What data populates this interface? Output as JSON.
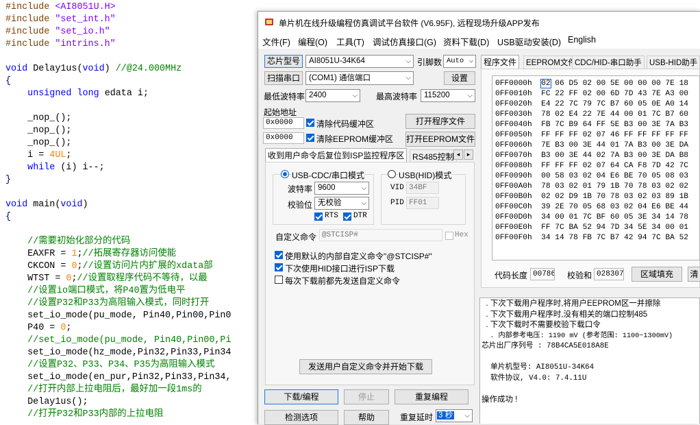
{
  "editor": {
    "lines": [
      {
        "parts": [
          [
            "pp",
            "#include "
          ],
          [
            "str",
            "<AI8051U.H>"
          ]
        ]
      },
      {
        "parts": [
          [
            "pp",
            "#include "
          ],
          [
            "str",
            "\"set_int.h\""
          ]
        ]
      },
      {
        "parts": [
          [
            "pp",
            "#include "
          ],
          [
            "str",
            "\"set_io.h\""
          ]
        ]
      },
      {
        "parts": [
          [
            "pp",
            "#include "
          ],
          [
            "str",
            "\"intrins.h\""
          ]
        ]
      },
      {
        "parts": []
      },
      {
        "parts": [
          [
            "kw",
            "void"
          ],
          [
            "tx",
            " Delay1us("
          ],
          [
            "kw",
            "void"
          ],
          [
            "tx",
            ") "
          ],
          [
            "cm",
            "//@24.000MHz"
          ]
        ]
      },
      {
        "parts": [
          [
            "op",
            "{"
          ]
        ]
      },
      {
        "parts": [
          [
            "tx",
            "    "
          ],
          [
            "kw",
            "unsigned"
          ],
          [
            "tx",
            " "
          ],
          [
            "kw",
            "long"
          ],
          [
            "tx",
            " edata i;"
          ]
        ]
      },
      {
        "parts": []
      },
      {
        "parts": [
          [
            "tx",
            "    _nop_();"
          ]
        ]
      },
      {
        "parts": [
          [
            "tx",
            "    _nop_();"
          ]
        ]
      },
      {
        "parts": [
          [
            "tx",
            "    _nop_();"
          ]
        ]
      },
      {
        "parts": [
          [
            "tx",
            "    i = "
          ],
          [
            "num",
            "4UL"
          ],
          [
            "tx",
            ";"
          ]
        ]
      },
      {
        "parts": [
          [
            "tx",
            "    "
          ],
          [
            "kw",
            "while"
          ],
          [
            "tx",
            " (i) i--;"
          ]
        ]
      },
      {
        "parts": [
          [
            "op",
            "}"
          ]
        ]
      },
      {
        "parts": []
      },
      {
        "parts": [
          [
            "kw",
            "void"
          ],
          [
            "tx",
            " main("
          ],
          [
            "kw",
            "void"
          ],
          [
            "tx",
            ")"
          ]
        ]
      },
      {
        "parts": [
          [
            "op",
            "{"
          ]
        ]
      },
      {
        "parts": []
      },
      {
        "parts": [
          [
            "tx",
            "    "
          ],
          [
            "cm",
            "//需要初始化部分的代码"
          ]
        ]
      },
      {
        "parts": [
          [
            "tx",
            "    EAXFR = "
          ],
          [
            "num",
            "1"
          ],
          [
            "tx",
            ";"
          ],
          [
            "cm",
            "//拓展寄存器访问使能"
          ]
        ]
      },
      {
        "parts": [
          [
            "tx",
            "    CKCON = "
          ],
          [
            "num",
            "0"
          ],
          [
            "tx",
            ";"
          ],
          [
            "cm",
            "//设置访问片内扩展的xdata部"
          ]
        ]
      },
      {
        "parts": [
          [
            "tx",
            "    WTST = "
          ],
          [
            "num",
            "0"
          ],
          [
            "tx",
            ";"
          ],
          [
            "cm",
            "//设置取程序代码不等待，以最"
          ]
        ]
      },
      {
        "parts": [
          [
            "tx",
            "    "
          ],
          [
            "cm",
            "//设置io端口模式，将P40置为低电平"
          ]
        ]
      },
      {
        "parts": [
          [
            "tx",
            "    "
          ],
          [
            "cm",
            "//设置P32和P33为高阻输入模式，同时打开"
          ]
        ]
      },
      {
        "parts": [
          [
            "tx",
            "    set_io_mode(pu_mode, Pin40,Pin00,Pin0"
          ]
        ]
      },
      {
        "parts": [
          [
            "tx",
            "    P40 = "
          ],
          [
            "num",
            "0"
          ],
          [
            "tx",
            ";"
          ]
        ]
      },
      {
        "parts": [
          [
            "tx",
            "    "
          ],
          [
            "cm",
            "//set_io_mode(pu_mode, Pin40,Pin00,Pi"
          ]
        ]
      },
      {
        "parts": [
          [
            "tx",
            "    set_io_mode(hz_mode,Pin32,Pin33,Pin34"
          ]
        ]
      },
      {
        "parts": [
          [
            "tx",
            "    "
          ],
          [
            "cm",
            "//设置P32、P33、P34、P35为高阻输入模式"
          ]
        ]
      },
      {
        "parts": [
          [
            "tx",
            "    set_io_mode(en_pur,Pin32,Pin33,Pin34,"
          ]
        ]
      },
      {
        "parts": [
          [
            "tx",
            "    "
          ],
          [
            "cm",
            "//打开内部上拉电阻后，最好加一段1ms的"
          ]
        ]
      },
      {
        "parts": [
          [
            "tx",
            "    Delay1us();"
          ]
        ]
      },
      {
        "parts": [
          [
            "tx",
            "    "
          ],
          [
            "cm",
            "//打开P32和P33内部的上拉电阻"
          ]
        ]
      }
    ]
  },
  "window": {
    "title": "单片机在线升级编程仿真调试平台软件 (V6.95F), 远程现场升级APP发布",
    "menu": [
      "文件(F)",
      "编程(O)",
      "工具(T)",
      "调试仿真接口(G)",
      "资料下载(D)",
      "USB驱动安装(D)",
      "English"
    ]
  },
  "left": {
    "chip_type_btn": "芯片型号",
    "chip_type_value": "AI8051U-34K64",
    "pins_label": "引脚数",
    "pins_value": "Auto",
    "scan_btn": "扫描串口",
    "port_value": "(COM1) 通信端口",
    "settings_btn": "设置",
    "min_baud_label": "最低波特率",
    "min_baud_value": "2400",
    "max_baud_label": "最高波特率",
    "max_baud_value": "115200",
    "start_addr_label": "起始地址",
    "addr1": "0x0000",
    "clear_code_label": "清除代码缓冲区",
    "open_prog_btn": "打开程序文件",
    "addr2": "0x0000",
    "clear_eeprom_label": "清除EEPROM缓冲区",
    "open_eeprom_btn": "打开EEPROM文件",
    "tab_isp": "收到用户命令后复位到ISP监控程序区",
    "tab_rs485": "RS485控制",
    "usb_cdc_label": "USB-CDC/串口模式",
    "usb_hid_label": "USB(HID)模式",
    "baud_label": "波特率",
    "baud_value": "9600",
    "parity_label": "校验位",
    "parity_value": "无校验",
    "rts_label": "RTS",
    "dtr_label": "DTR",
    "vid_label": "VID",
    "vid_value": "34BF",
    "pid_label": "PID",
    "pid_value": "FF01",
    "custom_cmd_label": "自定义命令",
    "custom_cmd_value": "@STCISP#",
    "hex_label": "Hex",
    "use_default_label": "使用默认的内部自定义命令\"@STCISP#\"",
    "hid_isp_label": "下次使用HID接口进行ISP下载",
    "send_each_label": "每次下载前都先发送自定义命令",
    "send_custom_btn": "发送用户自定义命令并开始下载",
    "download_btn": "下载/编程",
    "stop_btn": "停止",
    "reprogram_btn": "重复编程",
    "check_btn": "检测选项",
    "help_btn": "帮助",
    "repeat_delay_label": "重复延时",
    "repeat_delay_value": "3 秒"
  },
  "right": {
    "tabs": [
      "程序文件",
      "EEPROM文件",
      "CDC/HID-串口助手",
      "USB-HID助手"
    ],
    "hex_rows": [
      {
        "addr": "0FF0000h",
        "bytes": "02 06 D5 02 00 5E 00 00 00 7E 18"
      },
      {
        "addr": "0FF0010h",
        "bytes": "FC 22 FF 02 00 6D 7D 43 7E A3 00"
      },
      {
        "addr": "0FF0020h",
        "bytes": "E4 22 7C 79 7C B7 60 05 0E A0 14"
      },
      {
        "addr": "0FF0030h",
        "bytes": "78 02 E4 22 7E 44 00 01 7C B7 60"
      },
      {
        "addr": "0FF0040h",
        "bytes": "FB 7C B9 64 FF 5E B3 00 3E 7A B3"
      },
      {
        "addr": "0FF0050h",
        "bytes": "FF FF FF 02 07 46 FF FF FF FF FF"
      },
      {
        "addr": "0FF0060h",
        "bytes": "7E B3 00 3E 44 01 7A B3 00 3E DA"
      },
      {
        "addr": "0FF0070h",
        "bytes": "B3 00 3E 44 02 7A B3 00 3E DA B8"
      },
      {
        "addr": "0FF0080h",
        "bytes": "FF FF FF 02 07 64 CA F8 7D 42 7C"
      },
      {
        "addr": "0FF0090h",
        "bytes": "00 58 03 02 04 E6 BE 70 05 08 03"
      },
      {
        "addr": "0FF00A0h",
        "bytes": "78 03 02 01 79 1B 70 78 03 02 02"
      },
      {
        "addr": "0FF00B0h",
        "bytes": "02 02 D9 1B 70 78 03 02 03 89 1B"
      },
      {
        "addr": "0FF00C0h",
        "bytes": "39 2E 70 05 68 03 02 04 E6 BE 44"
      },
      {
        "addr": "0FF00D0h",
        "bytes": "34 00 01 7C BF 60 05 3E 34 14 78"
      },
      {
        "addr": "0FF00E0h",
        "bytes": "FF 7C BA 52 94 7D 34 5E 34 00 01"
      },
      {
        "addr": "0FF00F0h",
        "bytes": "34 14 78 FB 7C B7 42 94 7C BA 52"
      }
    ],
    "code_len_label": "代码长度",
    "code_len_value": "00786",
    "checksum_label": "校验和",
    "checksum_value": "028307",
    "fill_btn": "区域填充",
    "clear_btn": "清",
    "log_lines": [
      "  . 下次下载用户程序时,将用户EEPROM区一并擦除",
      "  . 下次下载用户程序时,没有相关的端口控制485",
      "  . 下次下载时不需要校验下载口令",
      "  . 内部参考电压: 1190 mV (参考范围: 1100~1300mV)",
      "芯片出厂序列号 : 78B4CA5E018A8E",
      "",
      "  单片机型号: AI8051U-34K64",
      "  软件协议, V4.0: 7.4.11U",
      "",
      "操作成功 !"
    ]
  },
  "colors": {
    "comment": "#008000",
    "keyword": "#0000ff",
    "string": "#8000ff",
    "number": "#ff8000",
    "preproc": "#804000",
    "accent": "#0a64d8"
  }
}
